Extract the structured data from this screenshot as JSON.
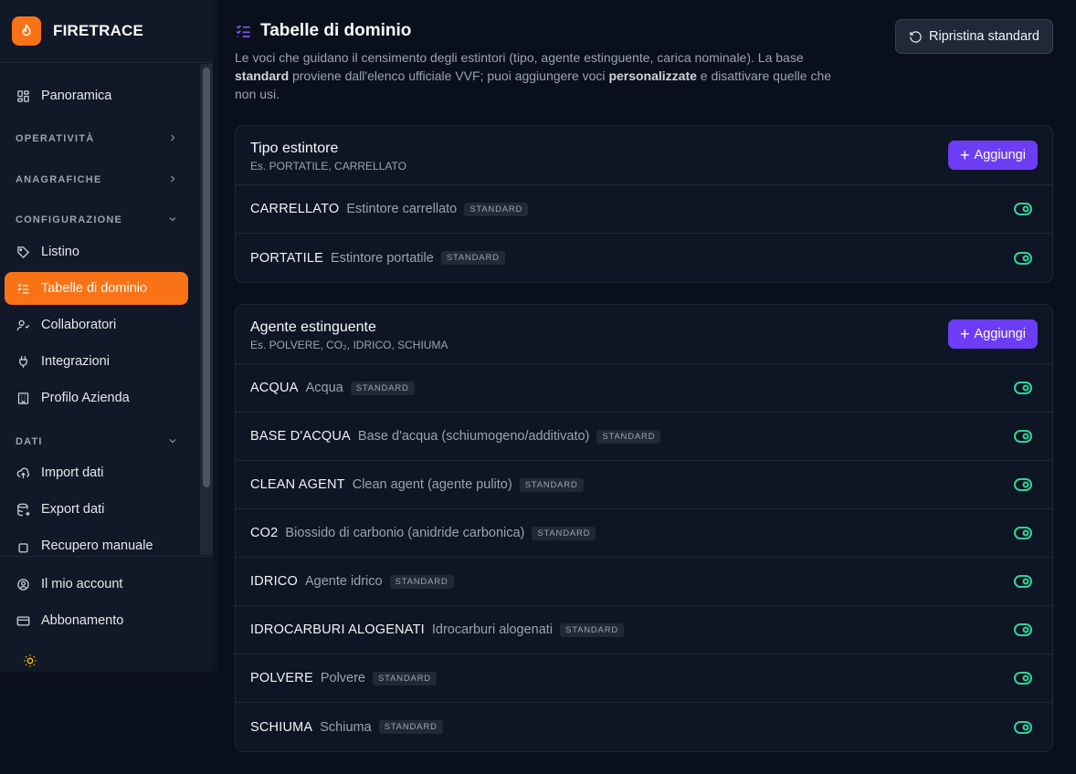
{
  "app": {
    "name": "FIRETRACE"
  },
  "sidebar": {
    "top_items": [
      {
        "label": "Panoramica",
        "icon": "dashboard-icon"
      }
    ],
    "sections": [
      {
        "label": "OPERATIVITÀ",
        "state": "collapsed"
      },
      {
        "label": "ANAGRAFICHE",
        "state": "collapsed"
      },
      {
        "label": "CONFIGURAZIONE",
        "state": "expanded"
      },
      {
        "label": "DATI",
        "state": "expanded"
      }
    ],
    "config_items": [
      {
        "label": "Listino",
        "icon": "tag-icon"
      },
      {
        "label": "Tabelle di dominio",
        "icon": "list-check-icon",
        "active": true
      },
      {
        "label": "Collaboratori",
        "icon": "users-icon"
      },
      {
        "label": "Integrazioni",
        "icon": "plug-icon"
      },
      {
        "label": "Profilo Azienda",
        "icon": "building-icon"
      }
    ],
    "data_items": [
      {
        "label": "Import dati",
        "icon": "cloud-upload-icon"
      },
      {
        "label": "Export dati",
        "icon": "database-export-icon"
      },
      {
        "label": "Recupero manuale",
        "icon": "file-icon"
      }
    ],
    "bottom_items": [
      {
        "label": "Il mio account",
        "icon": "user-circle-icon"
      },
      {
        "label": "Abbonamento",
        "icon": "credit-card-icon"
      }
    ],
    "theme_icon": "sun-icon"
  },
  "page": {
    "title": "Tabelle di dominio",
    "desc_part1": "Le voci che guidano il censimento degli estintori (tipo, agente estinguente, carica nominale). La base ",
    "desc_bold1": "standard",
    "desc_part2": " proviene dall'elenco ufficiale VVF; puoi aggiungere voci ",
    "desc_bold2": "personalizzate",
    "desc_part3": " e disattivare quelle che non usi.",
    "reset_label": "Ripristina standard"
  },
  "tables": [
    {
      "title": "Tipo estintore",
      "subtitle": "Es. PORTATILE, CARRELLATO",
      "add_label": "Aggiungi",
      "rows": [
        {
          "code": "CARRELLATO",
          "desc": "Estintore carrellato",
          "badge": "STANDARD",
          "enabled": true
        },
        {
          "code": "PORTATILE",
          "desc": "Estintore portatile",
          "badge": "STANDARD",
          "enabled": true
        }
      ]
    },
    {
      "title": "Agente estinguente",
      "subtitle": "Es. POLVERE, CO₂, IDRICO, SCHIUMA",
      "add_label": "Aggiungi",
      "rows": [
        {
          "code": "ACQUA",
          "desc": "Acqua",
          "badge": "STANDARD",
          "enabled": true
        },
        {
          "code": "BASE D'ACQUA",
          "desc": "Base d'acqua (schiumogeno/additivato)",
          "badge": "STANDARD",
          "enabled": true
        },
        {
          "code": "CLEAN AGENT",
          "desc": "Clean agent (agente pulito)",
          "badge": "STANDARD",
          "enabled": true
        },
        {
          "code": "CO2",
          "desc": "Biossido di carbonio (anidride carbonica)",
          "badge": "STANDARD",
          "enabled": true
        },
        {
          "code": "IDRICO",
          "desc": "Agente idrico",
          "badge": "STANDARD",
          "enabled": true
        },
        {
          "code": "IDROCARBURI ALOGENATI",
          "desc": "Idrocarburi alogenati",
          "badge": "STANDARD",
          "enabled": true
        },
        {
          "code": "POLVERE",
          "desc": "Polvere",
          "badge": "STANDARD",
          "enabled": true
        },
        {
          "code": "SCHIUMA",
          "desc": "Schiuma",
          "badge": "STANDARD",
          "enabled": true
        }
      ]
    }
  ],
  "colors": {
    "accent": "#f97316",
    "primary": "#6d3df5",
    "toggle_on": "#34d399"
  }
}
